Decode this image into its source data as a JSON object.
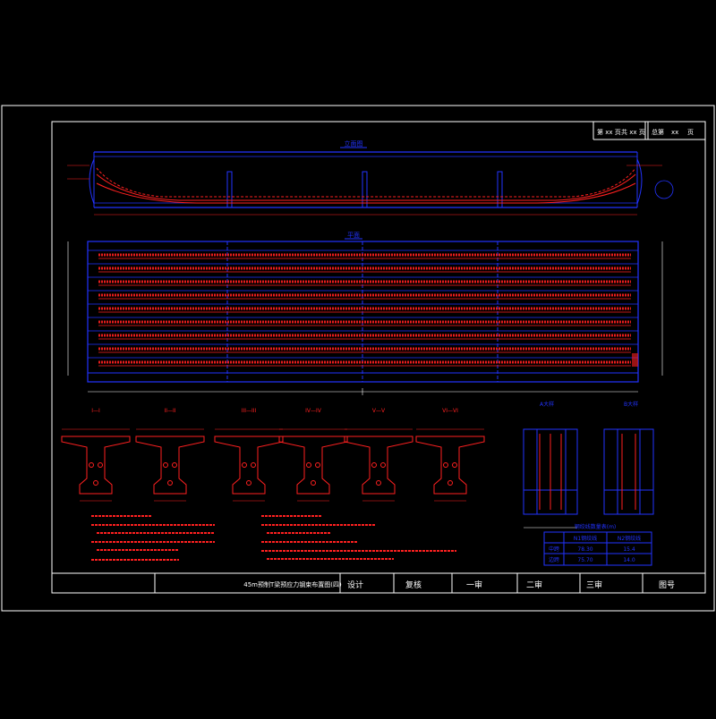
{
  "page_header": {
    "sheet_no": "第 xx 页",
    "sheet_total": "共 xx 页",
    "drawing_label": "总第",
    "drawing_no": "xx",
    "drawing_page": "页"
  },
  "views": {
    "elevation_title": "立面图",
    "plan_title": "平面",
    "sections": [
      "I—I",
      "II—II",
      "III—III",
      "IV—IV",
      "V—V",
      "VI—VI"
    ],
    "detail_a": "A大样",
    "detail_b": "B大样"
  },
  "table": {
    "caption": "钢绞线数量表(m)",
    "headers": [
      "",
      "N1钢绞线",
      "N2钢绞线"
    ],
    "rows": [
      [
        "中跨",
        "78.30",
        "15.4"
      ],
      [
        "边跨",
        "75.70",
        "14.0"
      ]
    ]
  },
  "title_block": {
    "drawing_title": "45m预制T梁预应力钢束布置图(四)",
    "design": "设计",
    "check": "复核",
    "review1": "一审",
    "review2": "二审",
    "review3": "三审",
    "drawing_number": "图号"
  },
  "colors": {
    "frame": "#ffffff",
    "structure": "#2233ff",
    "tendon": "#ff2020",
    "text": "#ffffff"
  }
}
